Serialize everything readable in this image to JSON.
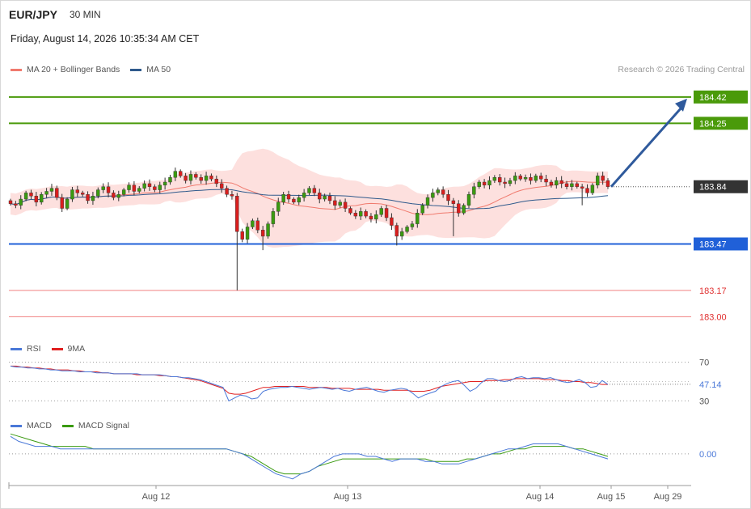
{
  "header": {
    "symbol": "EUR/JPY",
    "timeframe": "30 MIN",
    "datetime": "Friday, August 14, 2026 10:35:34 AM CET",
    "credit": "Research © 2026 Trading Central"
  },
  "legends": {
    "price": [
      {
        "label": "MA 20 + Bollinger Bands",
        "color": "#f07a6e"
      },
      {
        "label": "MA 50",
        "color": "#2f5a8c"
      }
    ],
    "rsi": [
      {
        "label": "RSI",
        "color": "#4a78d8"
      },
      {
        "label": "9MA",
        "color": "#e02020"
      }
    ],
    "macd": [
      {
        "label": "MACD",
        "color": "#4a78d8"
      },
      {
        "label": "MACD Signal",
        "color": "#3a9a10"
      }
    ]
  },
  "chart_data": [
    {
      "type": "candlestick",
      "ylim": [
        182.85,
        184.55
      ],
      "levels": [
        {
          "value": 184.42,
          "label": "184.42",
          "kind": "resistance",
          "color": "#4a9a0a"
        },
        {
          "value": 184.25,
          "label": "184.25",
          "kind": "resistance",
          "color": "#4a9a0a"
        },
        {
          "value": 183.84,
          "label": "183.84",
          "kind": "current",
          "color": "#333333"
        },
        {
          "value": 183.47,
          "label": "183.47",
          "kind": "pivot",
          "color": "#2060d8"
        },
        {
          "value": 183.17,
          "label": "183.17",
          "kind": "support",
          "color": "#e04040"
        },
        {
          "value": 183.0,
          "label": "183.00",
          "kind": "support",
          "color": "#e04040"
        }
      ],
      "x_ticks": [
        "Aug 12",
        "Aug 13",
        "Aug 14",
        "Aug 15",
        "Aug 29"
      ],
      "closes": [
        183.73,
        183.72,
        183.76,
        183.8,
        183.78,
        183.74,
        183.79,
        183.81,
        183.83,
        183.77,
        183.7,
        183.76,
        183.82,
        183.8,
        183.79,
        183.75,
        183.78,
        183.82,
        183.84,
        183.8,
        183.77,
        183.79,
        183.82,
        183.85,
        183.81,
        183.83,
        183.86,
        183.84,
        183.82,
        183.85,
        183.87,
        183.9,
        183.94,
        183.91,
        183.88,
        183.92,
        183.9,
        183.88,
        183.91,
        183.89,
        183.86,
        183.83,
        183.79,
        183.78,
        183.55,
        183.5,
        183.58,
        183.62,
        183.56,
        183.52,
        183.6,
        183.68,
        183.74,
        183.79,
        183.76,
        183.74,
        183.77,
        183.8,
        183.83,
        183.8,
        183.76,
        183.78,
        183.75,
        183.72,
        183.74,
        183.7,
        183.67,
        183.65,
        183.68,
        183.65,
        183.63,
        183.66,
        183.7,
        183.64,
        183.59,
        183.52,
        183.55,
        183.58,
        183.6,
        183.67,
        183.72,
        183.77,
        183.8,
        183.82,
        183.79,
        183.75,
        183.73,
        183.67,
        183.72,
        183.79,
        183.84,
        183.87,
        183.85,
        183.88,
        183.9,
        183.87,
        183.86,
        183.88,
        183.91,
        183.89,
        183.9,
        183.88,
        183.91,
        183.89,
        183.87,
        183.85,
        183.88,
        183.86,
        183.84,
        183.86,
        183.84,
        183.83,
        183.8,
        183.85,
        183.91,
        183.88,
        183.84
      ],
      "series": [
        {
          "name": "MA 20",
          "values": "derived from closes (20-period)"
        },
        {
          "name": "MA 50",
          "values": "derived from closes (50-period)"
        }
      ]
    },
    {
      "type": "line",
      "title": "RSI",
      "ylim": [
        22,
        78
      ],
      "y_ticks": [
        70,
        30
      ],
      "current_value": 47.14,
      "current_label": "47.14",
      "rsi": [
        66,
        65,
        65,
        64,
        64,
        63,
        63,
        62,
        62,
        61,
        61,
        61,
        60,
        60,
        60,
        59,
        59,
        59,
        58,
        58,
        58,
        58,
        58,
        57,
        57,
        57,
        57,
        56,
        55,
        55,
        54,
        54,
        53,
        52,
        50,
        48,
        46,
        44,
        30,
        33,
        36,
        35,
        32,
        33,
        40,
        42,
        43,
        44,
        44,
        45,
        44,
        43,
        42,
        43,
        44,
        43,
        42,
        43,
        41,
        40,
        42,
        43,
        44,
        42,
        40,
        39,
        41,
        42,
        43,
        42,
        38,
        33,
        36,
        38,
        40,
        45,
        48,
        50,
        51,
        46,
        40,
        43,
        49,
        53,
        53,
        51,
        50,
        51,
        54,
        55,
        53,
        54,
        54,
        53,
        54,
        52,
        50,
        49,
        50,
        52,
        49,
        44,
        45,
        51,
        47
      ],
      "ma9": [
        66,
        66,
        65,
        65,
        64,
        64,
        63,
        63,
        62,
        62,
        62,
        61,
        61,
        60,
        60,
        60,
        59,
        59,
        58,
        58,
        58,
        58,
        57,
        57,
        57,
        57,
        56,
        56,
        55,
        55,
        54,
        53,
        52,
        51,
        49,
        47,
        45,
        43,
        38,
        37,
        37,
        38,
        40,
        42,
        44,
        44,
        45,
        45,
        45,
        45,
        45,
        45,
        44,
        44,
        44,
        44,
        43,
        43,
        43,
        43,
        42,
        42,
        42,
        42,
        42,
        41,
        41,
        41,
        41,
        41,
        40,
        40,
        40,
        41,
        43,
        45,
        46,
        47,
        48,
        49,
        50,
        50,
        50,
        51,
        51,
        51,
        52,
        52,
        53,
        53,
        53,
        53,
        53,
        52,
        52,
        52,
        51,
        51,
        50,
        50,
        49,
        49,
        48,
        47,
        47
      ]
    },
    {
      "type": "line",
      "title": "MACD",
      "ylim": [
        -0.12,
        0.1
      ],
      "y_ticks": [
        0.0
      ],
      "y_tick_labels": [
        "0.00"
      ],
      "macd": [
        0.07,
        0.05,
        0.04,
        0.03,
        0.03,
        0.03,
        0.02,
        0.02,
        0.02,
        0.02,
        0.02,
        0.02,
        0.02,
        0.02,
        0.02,
        0.02,
        0.02,
        0.02,
        0.02,
        0.02,
        0.02,
        0.02,
        0.02,
        0.02,
        0.02,
        0.02,
        0.02,
        0.01,
        0.0,
        -0.02,
        -0.04,
        -0.06,
        -0.08,
        -0.09,
        -0.1,
        -0.08,
        -0.07,
        -0.05,
        -0.03,
        -0.01,
        0.0,
        0.0,
        0.0,
        -0.01,
        -0.01,
        -0.02,
        -0.03,
        -0.02,
        -0.02,
        -0.02,
        -0.03,
        -0.03,
        -0.04,
        -0.04,
        -0.04,
        -0.03,
        -0.02,
        -0.01,
        0.0,
        0.01,
        0.02,
        0.02,
        0.03,
        0.04,
        0.04,
        0.04,
        0.04,
        0.03,
        0.02,
        0.01,
        0.0,
        -0.01,
        -0.02
      ],
      "signal": [
        0.08,
        0.07,
        0.06,
        0.05,
        0.04,
        0.03,
        0.03,
        0.03,
        0.03,
        0.03,
        0.02,
        0.02,
        0.02,
        0.02,
        0.02,
        0.02,
        0.02,
        0.02,
        0.02,
        0.02,
        0.02,
        0.02,
        0.02,
        0.02,
        0.02,
        0.02,
        0.02,
        0.01,
        0.0,
        -0.01,
        -0.03,
        -0.05,
        -0.07,
        -0.08,
        -0.08,
        -0.08,
        -0.07,
        -0.05,
        -0.04,
        -0.03,
        -0.02,
        -0.02,
        -0.02,
        -0.02,
        -0.02,
        -0.02,
        -0.02,
        -0.02,
        -0.02,
        -0.02,
        -0.02,
        -0.03,
        -0.03,
        -0.03,
        -0.03,
        -0.02,
        -0.02,
        -0.01,
        0.0,
        0.0,
        0.01,
        0.02,
        0.02,
        0.03,
        0.03,
        0.03,
        0.03,
        0.03,
        0.02,
        0.02,
        0.01,
        0.0,
        -0.01
      ]
    }
  ]
}
